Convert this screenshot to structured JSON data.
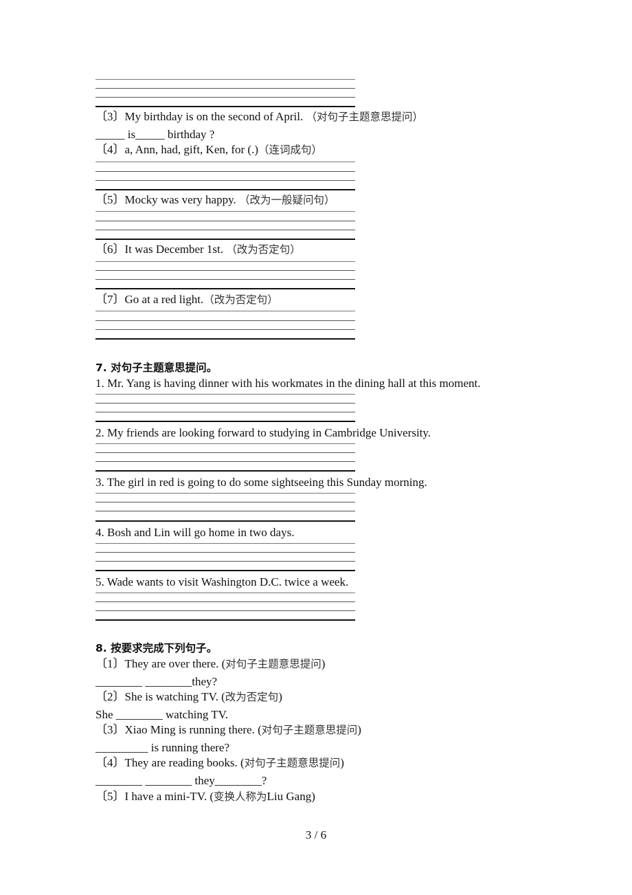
{
  "section6_tail": {
    "items": [
      {
        "num": "〔3〕",
        "text": "My birthday is on the second of April. ",
        "hint": "（对句子主题意思提问）",
        "answer_line": "_____ is_____ birthday ?"
      },
      {
        "num": "〔4〕",
        "text": "a,  Ann,  had,  gift,  Ken,  for (.)",
        "hint": "（连词成句）"
      },
      {
        "num": "〔5〕",
        "text": "Mocky was very happy. ",
        "hint": "（改为一般疑问句）"
      },
      {
        "num": "〔6〕",
        "text": "It was December 1st. ",
        "hint": "（改为否定句）"
      },
      {
        "num": "〔7〕",
        "text": "Go at a red light.",
        "hint": "（改为否定句）"
      }
    ]
  },
  "section7": {
    "title": "7.  对句子主题意思提问。",
    "items": [
      "1. Mr. Yang is having dinner with his workmates in the dining hall at this moment.",
      "2. My friends are looking forward to studying in Cambridge University.",
      "3. The girl in red is going to do some sightseeing this Sunday morning.",
      "4. Bosh and Lin will go home in two days.",
      "5. Wade wants to visit Washington D.C. twice a week."
    ]
  },
  "section8": {
    "title": "8.  按要求完成下列句子。",
    "items": [
      {
        "num": "〔1〕",
        "text": "They are over there. (",
        "hint": "对句子主题意思提问",
        "close": ")",
        "answer_line": "________ ________they?"
      },
      {
        "num": "〔2〕",
        "text": "She is watching TV. (",
        "hint": "改为否定句",
        "close": ")",
        "answer_line": "She ________ watching TV."
      },
      {
        "num": "〔3〕",
        "text": "Xiao Ming is running there. (",
        "hint": "对句子主题意思提问",
        "close": ")",
        "answer_line": "_________ is running there?"
      },
      {
        "num": "〔4〕",
        "text": "They are reading books. (",
        "hint": "对句子主题意思提问",
        "close": ")",
        "answer_line": "________ ________ they________?"
      },
      {
        "num": "〔5〕",
        "text": "I have a mini-TV. (",
        "hint": "变换人称为",
        "close": "Liu Gang)"
      }
    ]
  },
  "footer": {
    "page_indicator": "3 / 6"
  }
}
